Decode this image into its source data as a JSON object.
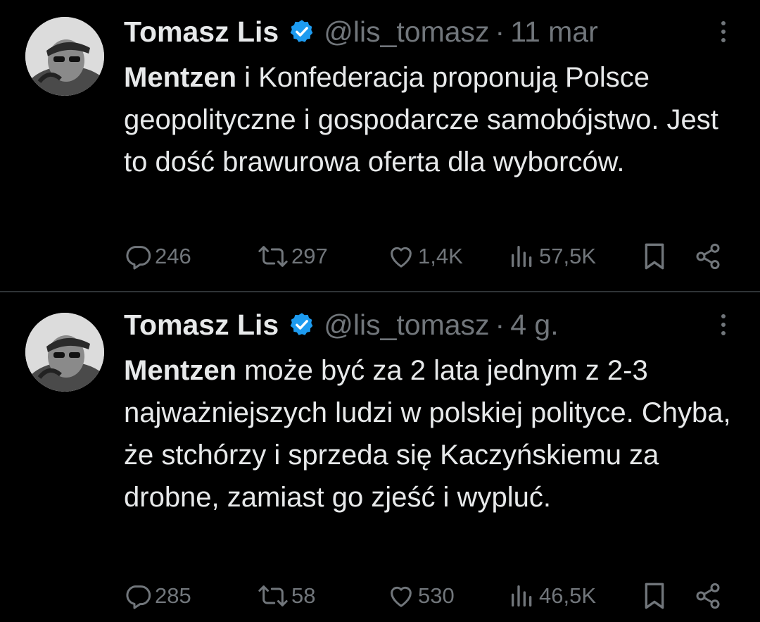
{
  "tweets": [
    {
      "display_name": "Tomasz Lis",
      "handle": "@lis_tomasz",
      "separator": "·",
      "time": "11 mar",
      "text_mention": "Mentzen",
      "text_rest": " i Konfederacja proponują Polsce geopolityczne i gospodarcze samobójstwo. Jest to dość brawurowa oferta dla wyborców.",
      "replies": "246",
      "retweets": "297",
      "likes": "1,4K",
      "views": "57,5K"
    },
    {
      "display_name": "Tomasz Lis",
      "handle": "@lis_tomasz",
      "separator": "·",
      "time": "4 g.",
      "text_mention": "Mentzen",
      "text_rest": " może być za 2 lata jednym z 2-3 najważniejszych ludzi w polskiej polityce. Chyba, że stchórzy i sprzeda się Kaczyńskiemu za drobne, zamiast go zjeść i wypluć.",
      "replies": "285",
      "retweets": "58",
      "likes": "530",
      "views": "46,5K"
    }
  ],
  "colors": {
    "background": "#000000",
    "text": "#e7e9ea",
    "secondary": "#71767b",
    "verified": "#1d9bf0",
    "divider": "#2f3336"
  },
  "icons": {
    "reply": "reply-icon",
    "retweet": "retweet-icon",
    "like": "heart-icon",
    "views": "views-icon",
    "bookmark": "bookmark-icon",
    "share": "share-icon",
    "more": "more-icon",
    "verified": "verified-badge-icon"
  }
}
